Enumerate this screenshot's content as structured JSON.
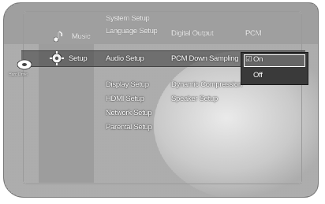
{
  "device": {
    "logo_text": "Hard Drive"
  },
  "main_menu": {
    "items": [
      {
        "label": "Music",
        "icon": "music-icon"
      },
      {
        "label": "Setup",
        "icon": "setup-gear-icon"
      }
    ]
  },
  "setup_menu": {
    "items": [
      "System Setup",
      "Language Setup",
      "Audio Setup",
      "Display Setup",
      "HDMI Setup",
      "Network Setup",
      "Parental Setup"
    ]
  },
  "audio_settings": {
    "items": [
      {
        "label": "Digital Output",
        "value": "PCM"
      },
      {
        "label": "PCM Down Sampling"
      },
      {
        "label": "Dynamic Compression"
      },
      {
        "label": "Speaker Setup"
      }
    ]
  },
  "dropdown": {
    "options": [
      "On",
      "Off"
    ],
    "selected_index": 0,
    "selected_marker": "☑"
  }
}
